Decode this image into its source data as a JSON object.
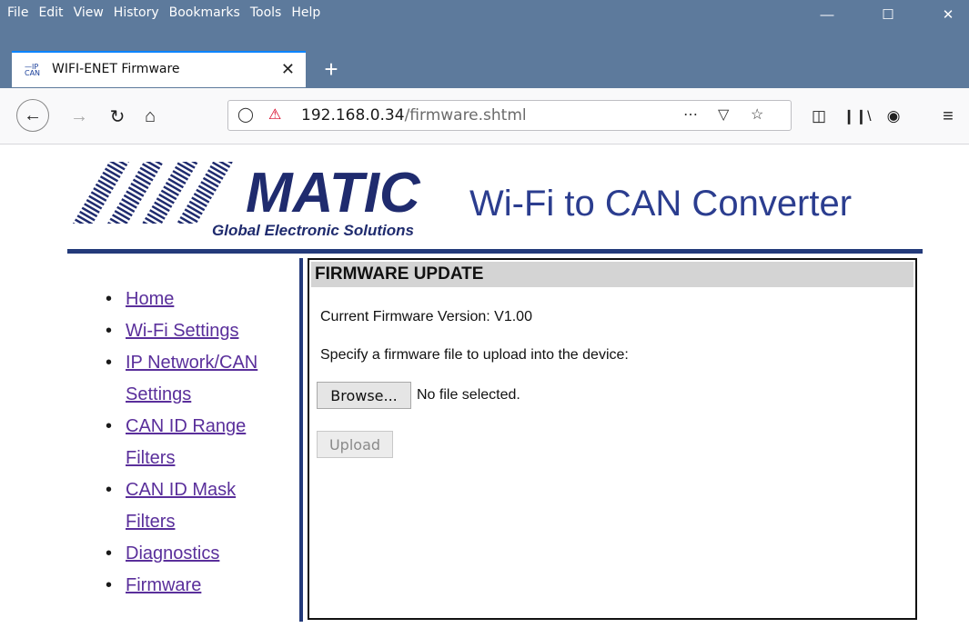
{
  "browser": {
    "menu": [
      "File",
      "Edit",
      "View",
      "History",
      "Bookmarks",
      "Tools",
      "Help"
    ],
    "tab_title": "WIFI-ENET Firmware",
    "favicon_text": "IP CAN",
    "url_host": "192.168.0.34",
    "url_path": "/firmware.shtml"
  },
  "header": {
    "logo_text": "AXIOMATIC",
    "logo_subtitle": "Global Electronic Solutions",
    "title": "Wi-Fi to CAN Converter"
  },
  "nav": {
    "items": [
      {
        "label": "Home"
      },
      {
        "label": "Wi-Fi Settings"
      },
      {
        "label": "IP Network/CAN Settings"
      },
      {
        "label": "CAN ID Range Filters"
      },
      {
        "label": "CAN ID Mask Filters"
      },
      {
        "label": "Diagnostics"
      },
      {
        "label": "Firmware"
      }
    ]
  },
  "panel": {
    "heading": "FIRMWARE UPDATE",
    "version_text": "Current Firmware Version: V1.00",
    "instruction": "Specify a firmware file to upload into the device:",
    "browse_label": "Browse...",
    "file_status": "No file selected.",
    "upload_label": "Upload"
  },
  "colors": {
    "chrome": "#5d7a9c",
    "accent": "#233a7a",
    "link": "#5a2f9b"
  }
}
